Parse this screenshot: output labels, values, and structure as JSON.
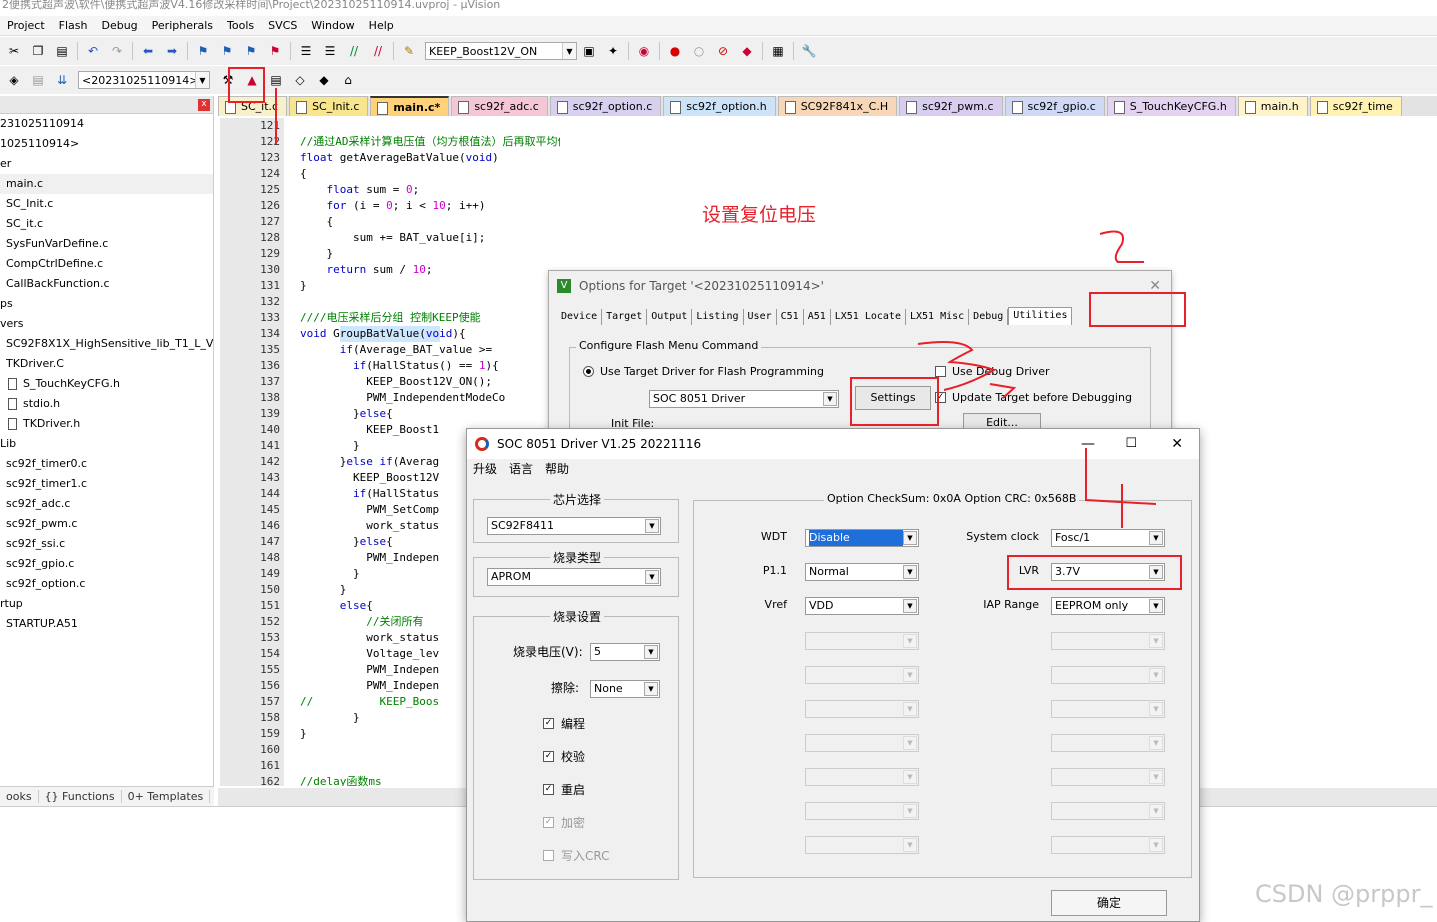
{
  "window": {
    "title": "2便携式超声波\\软件\\便携式超声波V4.16修改采样时间\\Project\\20231025110914.uvproj - µVision"
  },
  "menu": [
    "Project",
    "Flash",
    "Debug",
    "Peripherals",
    "Tools",
    "SVCS",
    "Window",
    "Help"
  ],
  "toolbar": {
    "target_combo": "KEEP_Boost12V_ON",
    "build_target_combo": "<20231025110914>"
  },
  "project": {
    "header_close": "x",
    "items": [
      {
        "label": "231025110914",
        "indent": 0
      },
      {
        "label": "1025110914>",
        "indent": 0
      },
      {
        "label": "er",
        "indent": 0
      },
      {
        "label": "main.c",
        "indent": 6
      },
      {
        "label": "SC_Init.c",
        "indent": 6
      },
      {
        "label": "SC_it.c",
        "indent": 6
      },
      {
        "label": "SysFunVarDefine.c",
        "indent": 6
      },
      {
        "label": "CompCtrlDefine.c",
        "indent": 6
      },
      {
        "label": "CallBackFunction.c",
        "indent": 6
      },
      {
        "label": "ps",
        "indent": 0
      },
      {
        "label": "vers",
        "indent": 0
      },
      {
        "label": "SC92F8X1X_HighSensitive_lib_T1_L_V2.3",
        "indent": 6
      },
      {
        "label": "TKDriver.C",
        "indent": 6
      },
      {
        "label": "S_TouchKeyCFG.h",
        "indent": 26
      },
      {
        "label": "stdio.h",
        "indent": 26
      },
      {
        "label": "TKDriver.h",
        "indent": 26
      },
      {
        "label": "Lib",
        "indent": 0
      },
      {
        "label": "sc92f_timer0.c",
        "indent": 6
      },
      {
        "label": "sc92f_timer1.c",
        "indent": 6
      },
      {
        "label": "sc92f_adc.c",
        "indent": 6
      },
      {
        "label": "sc92f_pwm.c",
        "indent": 6
      },
      {
        "label": "sc92f_ssi.c",
        "indent": 6
      },
      {
        "label": "sc92f_gpio.c",
        "indent": 6
      },
      {
        "label": "sc92f_option.c",
        "indent": 6
      },
      {
        "label": "rtup",
        "indent": 0
      },
      {
        "label": "STARTUP.A51",
        "indent": 6
      }
    ],
    "bottom_tabs": [
      "ooks",
      "{} Functions",
      "0+ Templates"
    ]
  },
  "tabs": [
    "SC_it.c",
    "SC_Init.c",
    "main.c*",
    "sc92f_adc.c",
    "sc92f_option.c",
    "sc92f_option.h",
    "SC92F841x_C.H",
    "sc92f_pwm.c",
    "sc92f_gpio.c",
    "S_TouchKeyCFG.h",
    "main.h",
    "sc92f_time"
  ],
  "tab_colors": [
    "#f7f0c8",
    "#f7e68e",
    "#ffd27a",
    "#f5c6d6",
    "#d9d0f0",
    "#cde3f7",
    "#f7d7b8",
    "#d8cdef",
    "#cfd9f5",
    "#e3d3f1",
    "#fff4c7",
    "#fff2b3"
  ],
  "editor": {
    "line_numbers": [
      "121",
      "122",
      "123",
      "124",
      "125",
      "126",
      "127",
      "128",
      "129",
      "130",
      "131",
      "132",
      "133",
      "134",
      "135",
      "136",
      "137",
      "138",
      "139",
      "140",
      "141",
      "142",
      "143",
      "144",
      "145",
      "146",
      "147",
      "148",
      "149",
      "150",
      "151",
      "152",
      "153",
      "154",
      "155",
      "156",
      "157",
      "158",
      "159",
      "160",
      "161",
      "162"
    ],
    "lines": [
      "",
      "//通过AD采样计算电压值（均方根值法）后再取平均值   返回平均值",
      "float getAverageBatValue(void)",
      "{",
      "    float sum = 0;",
      "    for (i = 0; i < 10; i++)",
      "    {",
      "        sum += BAT_value[i];",
      "    }",
      "    return sum / 10;",
      "}",
      "",
      "////电压采样后分组 控制KEEP使能",
      "void GroupBatValue(void){",
      "      if(Average_BAT_value >=",
      "        if(HallStatus() == 1){",
      "          KEEP_Boost12V_ON();",
      "          PWM_IndependentModeCo",
      "        }else{",
      "          KEEP_Boost1",
      "        }",
      "      }else if(Averag",
      "        KEEP_Boost12V",
      "        if(HallStatus",
      "          PWM_SetComp",
      "          work_status",
      "        }else{",
      "          PWM_Indepen",
      "        }",
      "      }",
      "      else{",
      "          //关闭所有",
      "          work_status",
      "          Voltage_lev",
      "          PWM_Indepen",
      "          PWM_Indepen",
      "//          KEEP_Boos",
      "        }",
      "}",
      "",
      "",
      "//delay函数ms"
    ],
    "annotation_text": "设置复位电压"
  },
  "options_dialog": {
    "title": "Options for Target '<20231025110914>'",
    "tabs": [
      "Device",
      "Target",
      "Output",
      "Listing",
      "User",
      "C51",
      "A51",
      "LX51 Locate",
      "LX51 Misc",
      "Debug",
      "Utilities"
    ],
    "group_label": "Configure Flash Menu Command",
    "radio_label": "Use Target Driver for Flash Programming",
    "driver_value": "SOC 8051 Driver",
    "settings_button": "Settings",
    "use_debug_driver": "Use Debug Driver",
    "update_target": "Update Target before Debugging",
    "init_file": "Init File:",
    "edit_button": "Edit..."
  },
  "driver_dialog": {
    "title": "SOC 8051 Driver V1.25 20221116",
    "menu": [
      "升级",
      "语言",
      "帮助"
    ],
    "chip_group": "芯片选择",
    "chip_value": "SC92F8411",
    "burn_type_group": "烧录类型",
    "burn_type_value": "APROM",
    "burn_settings_group": "烧录设置",
    "voltage_label": "烧录电压(V):",
    "voltage_value": "5",
    "erase_label": "擦除:",
    "erase_value": "None",
    "checks": [
      {
        "label": "编程",
        "checked": true,
        "enabled": true
      },
      {
        "label": "校验",
        "checked": true,
        "enabled": true
      },
      {
        "label": "重启",
        "checked": true,
        "enabled": true
      },
      {
        "label": "加密",
        "checked": true,
        "enabled": false
      },
      {
        "label": "写入CRC",
        "checked": false,
        "enabled": false
      }
    ],
    "option_header": "Option CheckSum:  0x0A  Option CRC:  0x568B",
    "left_fields": [
      {
        "label": "WDT",
        "value": "Disable",
        "highlight": true
      },
      {
        "label": "P1.1",
        "value": "Normal"
      },
      {
        "label": "Vref",
        "value": "VDD"
      }
    ],
    "right_fields": [
      {
        "label": "System clock",
        "value": "Fosc/1"
      },
      {
        "label": "LVR",
        "value": "3.7V"
      },
      {
        "label": "IAP Range",
        "value": "EEPROM only"
      }
    ],
    "ok_button": "确定"
  },
  "watermark": "CSDN @prppr_"
}
